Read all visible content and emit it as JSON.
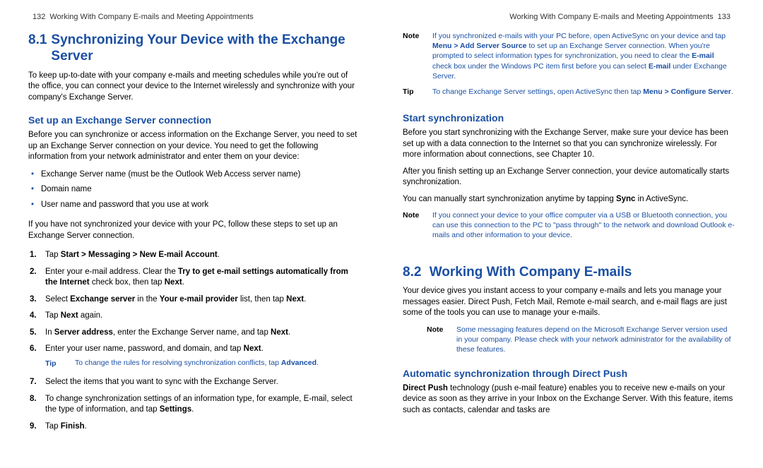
{
  "leftPage": {
    "pageNum": "132",
    "runningHead": "Working With Company E-mails and Meeting Appointments",
    "section81": {
      "num": "8.1",
      "title": "Synchronizing Your Device with the Exchange Server",
      "intro": "To keep up-to-date with your company e-mails and meeting schedules while you're out of the office, you can connect your device to the Internet wirelessly and synchronize with your company's Exchange Server.",
      "setup": {
        "heading": "Set up an Exchange Server connection",
        "para1": "Before you can synchronize or access information on the Exchange Server, you need to set up an Exchange Server connection on your device. You need to get the following information from your network administrator and enter them on your device:",
        "bullets": [
          "Exchange Server name (must be the Outlook Web Access server name)",
          "Domain name",
          "User name and password that you use at work"
        ],
        "para2": "If you have not synchronized your device with your PC, follow these steps to set up an Exchange Server connection.",
        "steps": {
          "s1_a": "Tap ",
          "s1_b": "Start > Messaging > New E-mail Account",
          "s1_c": ".",
          "s2_a": "Enter your e-mail address. Clear the ",
          "s2_b": "Try to get e-mail settings automatically from the Internet",
          "s2_c": " check box, then tap ",
          "s2_d": "Next",
          "s2_e": ".",
          "s3_a": "Select ",
          "s3_b": "Exchange server",
          "s3_c": " in the ",
          "s3_d": "Your e-mail provider",
          "s3_e": " list, then tap ",
          "s3_f": "Next",
          "s3_g": ".",
          "s4_a": "Tap ",
          "s4_b": "Next",
          "s4_c": " again.",
          "s5_a": "In ",
          "s5_b": "Server address",
          "s5_c": ", enter the Exchange Server name, and tap ",
          "s5_d": "Next",
          "s5_e": ".",
          "s6_a": "Enter your user name, password, and domain, and tap ",
          "s6_b": "Next",
          "s6_c": ".",
          "tip_label": "Tip",
          "tip_a": "To change the rules for resolving synchronization conflicts, tap ",
          "tip_b": "Advanced",
          "tip_c": ".",
          "s7": "Select the items that you want to sync with the Exchange Server.",
          "s8_a": "To change synchronization settings of an information type, for example, E-mail, select the type of information, and tap ",
          "s8_b": "Settings",
          "s8_c": ".",
          "s9_a": "Tap ",
          "s9_b": "Finish",
          "s9_c": "."
        }
      }
    }
  },
  "rightPage": {
    "pageNum": "133",
    "runningHead": "Working With Company E-mails and Meeting Appointments",
    "topNotes": {
      "note_label": "Note",
      "note_a": "If you synchronized e-mails with your PC before, open ActiveSync on your device and tap ",
      "note_b": "Menu > Add Server Source",
      "note_c": " to set up an Exchange Server connection. When you're prompted to select information types for synchronization, you need to clear the ",
      "note_d": "E-mail",
      "note_e": " check box under the Windows PC item first before you can select ",
      "note_f": "E-mail",
      "note_g": " under Exchange Server.",
      "tip_label": "Tip",
      "tip_a": "To change Exchange Server settings, open ActiveSync then tap ",
      "tip_b": "Menu > Configure Server",
      "tip_c": "."
    },
    "startSync": {
      "heading": "Start synchronization",
      "para1": "Before you start synchronizing with the Exchange Server, make sure your device has been set up with a data connection to the Internet so that you can synchronize wirelessly. For more information about connections, see Chapter 10.",
      "para2": "After you finish setting up an Exchange Server connection, your device automatically starts synchronization.",
      "para3_a": "You can manually start synchronization anytime by tapping ",
      "para3_b": "Sync",
      "para3_c": " in ActiveSync.",
      "note_label": "Note",
      "note_text": "If you connect your device to your office computer via a USB or Bluetooth connection, you can use this connection to the PC to \"pass through\" to the network and download Outlook e-mails and other information to your device."
    },
    "section82": {
      "num": "8.2",
      "title": "Working With Company E-mails",
      "intro": "Your device gives you instant access to your company e-mails and lets you manage your messages easier. Direct Push, Fetch Mail, Remote e-mail search, and e-mail flags are just some of the tools you can use to manage your e-mails.",
      "note_label": "Note",
      "note_text": "Some messaging features depend on the Microsoft Exchange Server version used in your company. Please check with your network administrator for the availability of these features.",
      "directPush": {
        "heading": "Automatic synchronization through Direct Push",
        "para_a": "Direct Push",
        "para_b": " technology (push e-mail feature) enables you to receive new e-mails on your device as soon as they arrive in your Inbox on the Exchange Server. With this feature, items such as contacts, calendar and tasks are"
      }
    }
  }
}
